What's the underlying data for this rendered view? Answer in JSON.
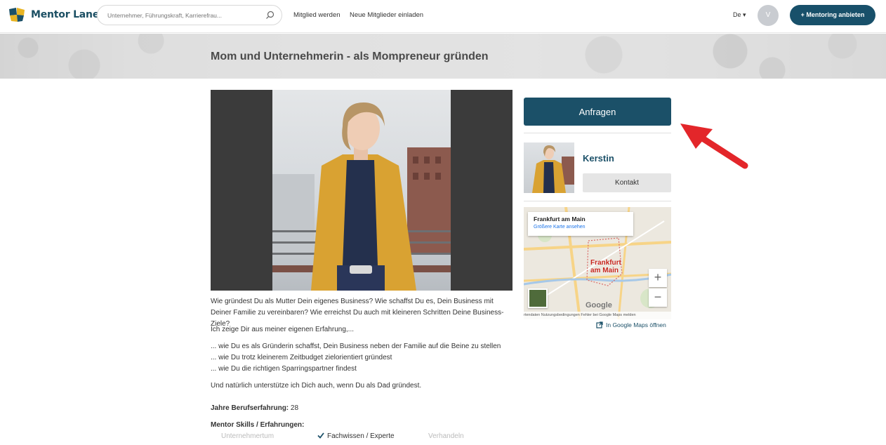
{
  "header": {
    "logo_text": "Mentor Lane",
    "search_placeholder": "Unternehmer, Führungskraft, Karrierefrau...",
    "nav": [
      {
        "label": "Mitglied werden"
      },
      {
        "label": "Neue Mitglieder einladen"
      }
    ],
    "language": "De ▾",
    "avatar_initial": "V",
    "cta_label": "+ Mentoring anbieten"
  },
  "banner": {
    "title": "Mom und Unternehmerin - als Mompreneur gründen"
  },
  "description": {
    "p1": "Wie gründest Du als Mutter Dein eigenes Business? Wie schaffst Du es, Dein Business mit Deiner Familie zu vereinbaren? Wie erreichst Du auch mit kleineren Schritten Deine Business-Ziele?",
    "p2": "Ich zeige Dir aus meiner eigenen Erfahrung,...",
    "bullets": [
      "... wie Du es als Gründerin schaffst, Dein Business neben der Familie auf die Beine zu stellen",
      "... wie Du trotz kleinerem Zeitbudget zielorientiert gründest",
      "... wie Du die richtigen Sparringspartner findest"
    ],
    "p3": "Und natürlich unterstütze ich Dich auch, wenn Du als Dad gründest."
  },
  "experience": {
    "label": "Jahre Berufserfahrung:",
    "value": "28"
  },
  "skills": {
    "label": "Mentor Skills / Erfahrungen:",
    "items": [
      {
        "label": "Unternehmertum",
        "active": false
      },
      {
        "label": "Fachwissen / Experte",
        "active": true
      },
      {
        "label": "Verhandeln",
        "active": false
      }
    ]
  },
  "sidebar": {
    "request_label": "Anfragen",
    "mentor_name": "Kerstin",
    "contact_label": "Kontakt",
    "map": {
      "card_title": "Frankfurt am Main",
      "card_link": "Größere Karte ansehen",
      "city_line1": "Frankfurt",
      "city_line2": "am Main",
      "zoom_in": "+",
      "zoom_out": "−",
      "footer": "rtendaten   Nutzungsbedingungen   Fehler bei Google Maps melden",
      "google": "Google"
    },
    "maps_link": "In Google Maps öffnen"
  },
  "colors": {
    "brand": "#1b5068",
    "annotation_arrow": "#e3262a"
  }
}
